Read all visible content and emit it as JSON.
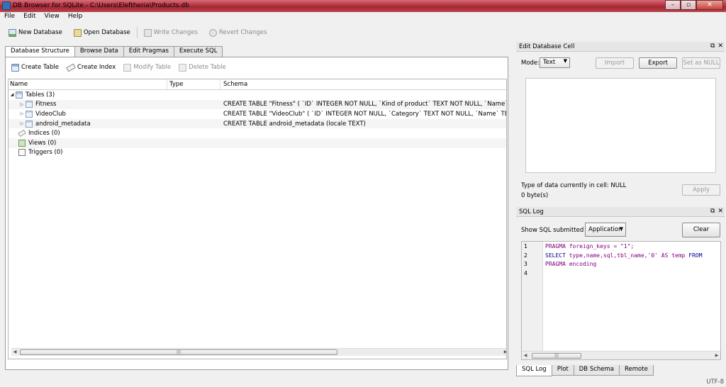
{
  "window": {
    "title": "DB Browser for SQLite - C:\\Users\\Eleftheria\\Products.db"
  },
  "menu": [
    "File",
    "Edit",
    "View",
    "Help"
  ],
  "toolbar": {
    "new_db": "New Database",
    "open_db": "Open Database",
    "write": "Write Changes",
    "revert": "Revert Changes"
  },
  "tabs": [
    "Database Structure",
    "Browse Data",
    "Edit Pragmas",
    "Execute SQL"
  ],
  "struct_toolbar": {
    "create_table": "Create Table",
    "create_index": "Create Index",
    "modify_table": "Modify Table",
    "delete_table": "Delete Table"
  },
  "tree": {
    "headers": {
      "name": "Name",
      "type": "Type",
      "schema": "Schema"
    },
    "tables_label": "Tables (3)",
    "tables": [
      {
        "name": "Fitness",
        "schema": "CREATE TABLE \"Fitness\" ( `ID` INTEGER NOT NULL, `Kind of product` TEXT NOT NULL, `Name` TEXT NO"
      },
      {
        "name": "VideoClub",
        "schema": "CREATE TABLE \"VideoClub\" ( `ID` INTEGER NOT NULL, `Category` TEXT NOT NULL, `Name` TEXT NOT"
      },
      {
        "name": "android_metadata",
        "schema": "CREATE TABLE android_metadata (locale TEXT)"
      }
    ],
    "indices_label": "Indices (0)",
    "views_label": "Views (0)",
    "triggers_label": "Triggers (0)"
  },
  "edit_cell": {
    "title": "Edit Database Cell",
    "mode_label": "Mode:",
    "mode_value": "Text",
    "import": "Import",
    "export": "Export",
    "set_null": "Set as NULL",
    "type_info": "Type of data currently in cell: NULL",
    "size_info": "0 byte(s)",
    "apply": "Apply"
  },
  "sql_log": {
    "title": "SQL Log",
    "show_label": "Show SQL submitted by",
    "source_value": "Application",
    "clear": "Clear",
    "line_numbers": [
      "1",
      "2",
      "3",
      "4"
    ],
    "lines": {
      "l1_kw": "PRAGMA",
      "l1_rest": " foreign_keys = \"1\";",
      "l2_kw": "SELECT",
      "l2_rest": " type,name,sql,tbl_name,'0' AS temp ",
      "l2_kw2": "FROM",
      "l3_kw": "PRAGMA",
      "l3_rest": " encoding"
    }
  },
  "bottom_tabs": [
    "SQL Log",
    "Plot",
    "DB Schema",
    "Remote"
  ],
  "status": {
    "encoding": "UTF-8"
  },
  "icons": {
    "dock_float": "restore-icon",
    "dock_close": "close-icon"
  }
}
